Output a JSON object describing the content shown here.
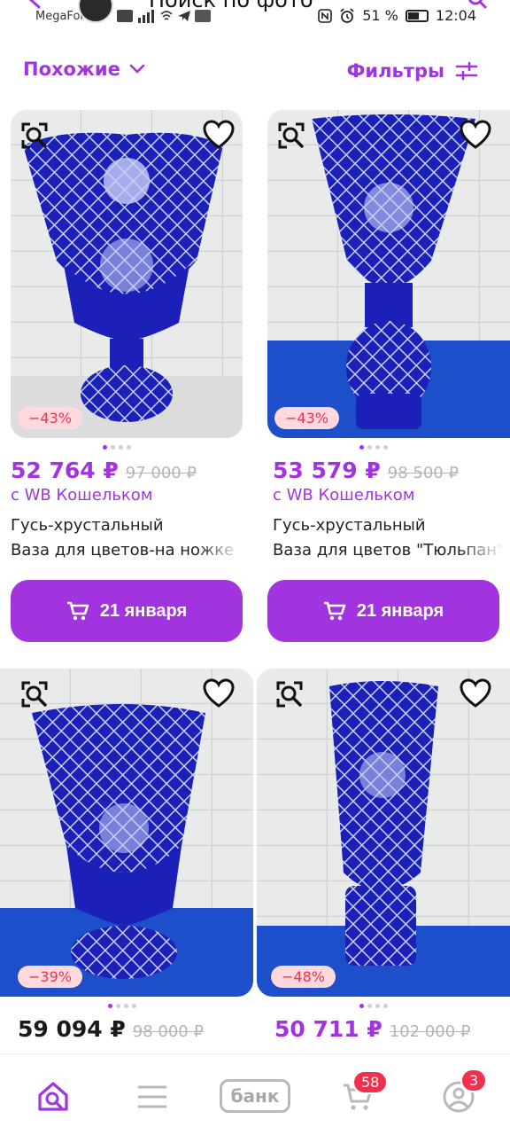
{
  "status_bar": {
    "carrier": "MegaFon",
    "page_title": "Поиск по фото",
    "battery": "51 %",
    "time": "12:04"
  },
  "toolbar": {
    "similar_label": "Похожие",
    "filters_label": "Фильтры"
  },
  "products": [
    {
      "discount": "−43%",
      "price": "52 764 ₽",
      "old_price": "97 000 ₽",
      "wallet": "с WB Кошельком",
      "brand": "Гусь-хрустальный",
      "name": "Ваза для цветов-на ножке",
      "delivery": "21 января"
    },
    {
      "discount": "−43%",
      "price": "53 579 ₽",
      "old_price": "98 500 ₽",
      "wallet": "с WB Кошельком",
      "brand": "Гусь-хрустальный",
      "name": "Ваза для цветов \"Тюльпан\"",
      "delivery": "21 января"
    },
    {
      "discount": "−39%",
      "price": "59 094 ₽",
      "old_price": "98 000 ₽"
    },
    {
      "discount": "−48%",
      "price": "50 711 ₽",
      "old_price": "102 000 ₽"
    }
  ],
  "bottom_nav": {
    "bank_label": "банк",
    "cart_count": "58",
    "profile_count": "3"
  },
  "colors": {
    "accent": "#a234e0",
    "discount": "#f1304e",
    "vase_blue": "#1a20b8"
  }
}
